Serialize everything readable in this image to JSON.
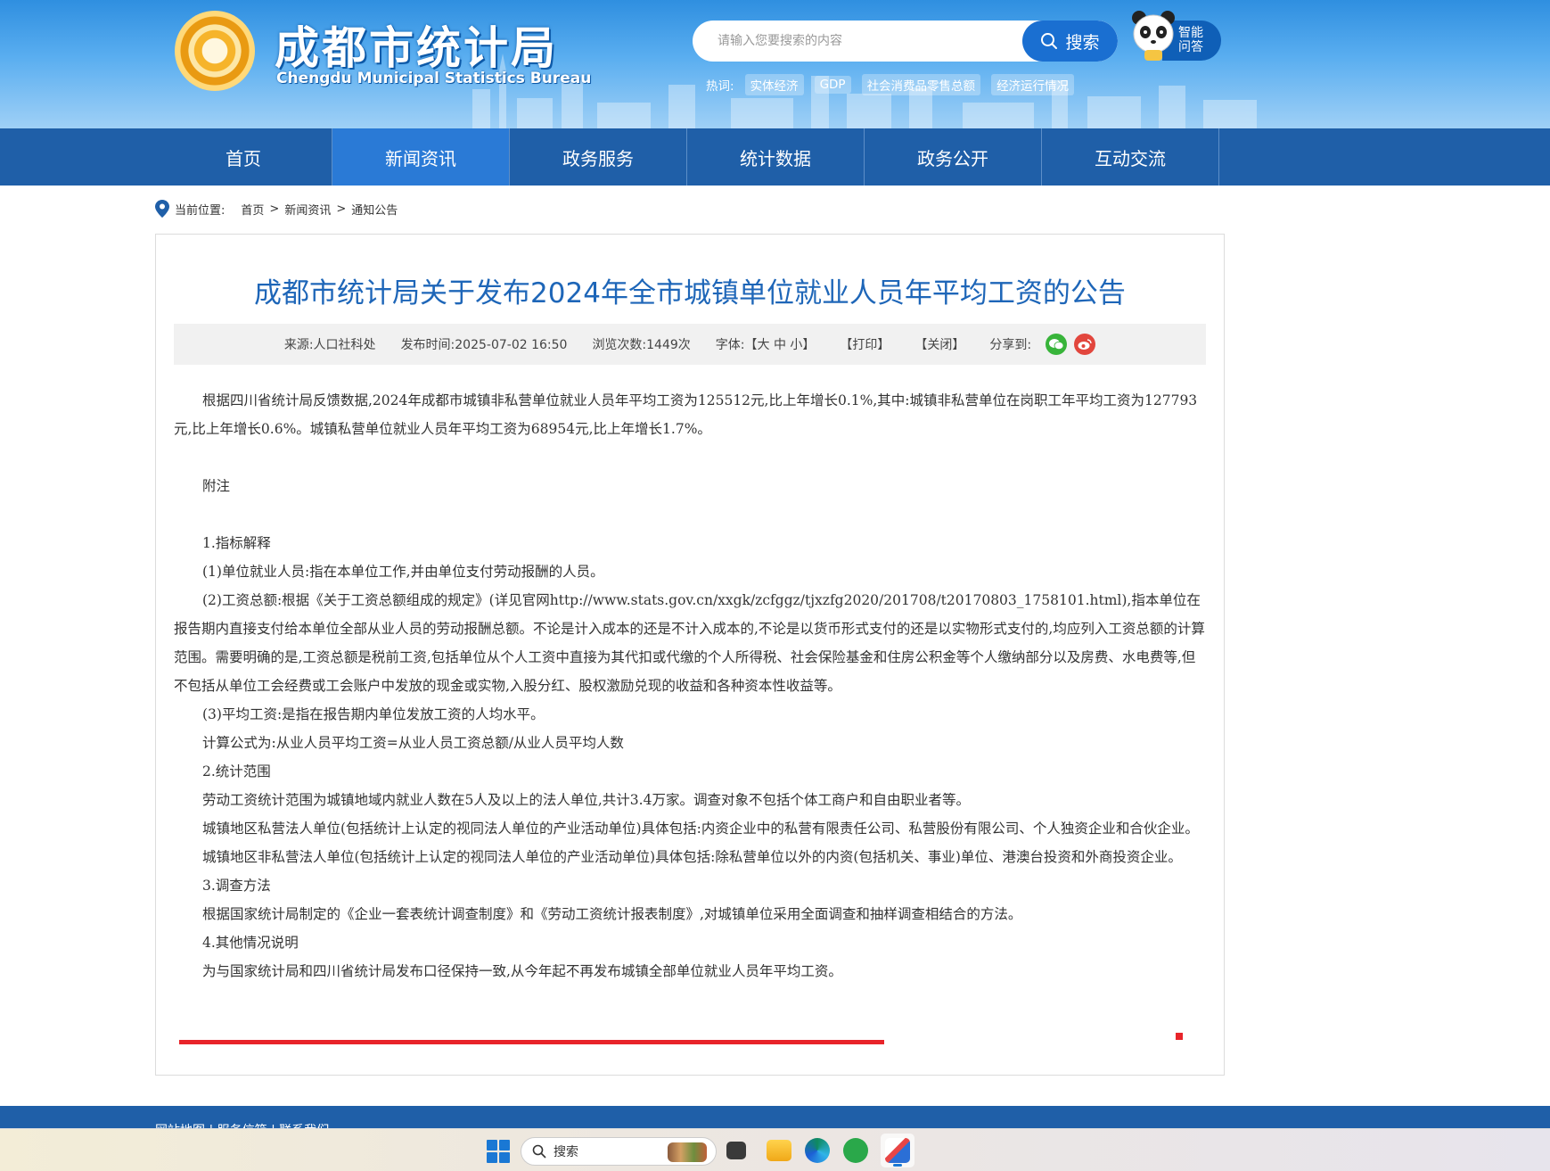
{
  "header": {
    "logo_cn": "成都市统计局",
    "logo_en": "Chengdu Municipal Statistics Bureau",
    "search_placeholder": "请输入您要搜索的内容",
    "search_button": "搜索",
    "ai_line1": "智能",
    "ai_line2": "问答",
    "hot_label": "热词:",
    "hot_tags": [
      "实体经济",
      "GDP",
      "社会消费品零售总额",
      "经济运行情况"
    ]
  },
  "nav": {
    "items": [
      "首页",
      "新闻资讯",
      "政务服务",
      "统计数据",
      "政务公开",
      "互动交流"
    ],
    "active_index": 1
  },
  "breadcrumb": {
    "label": "当前位置:",
    "items": [
      "首页",
      "新闻资讯",
      "通知公告"
    ],
    "sep": ">"
  },
  "article": {
    "title": "成都市统计局关于发布2024年全市城镇单位就业人员年平均工资的公告",
    "meta": {
      "source": "来源:人口社科处",
      "published": "发布时间:2025-07-02 16:50",
      "views": "浏览次数:1449次",
      "font": "字体:【大 中 小】",
      "print": "【打印】",
      "close": "【关闭】",
      "share": "分享到:"
    },
    "paragraphs": [
      "根据四川省统计局反馈数据,2024年成都市城镇非私营单位就业人员年平均工资为125512元,比上年增长0.1%,其中:城镇非私营单位在岗职工年平均工资为127793元,比上年增长0.6%。城镇私营单位就业人员年平均工资为68954元,比上年增长1.7%。",
      "",
      "附注",
      "",
      "1.指标解释",
      "(1)单位就业人员:指在本单位工作,并由单位支付劳动报酬的人员。",
      "(2)工资总额:根据《关于工资总额组成的规定》(详见官网http://www.stats.gov.cn/xxgk/zcfggz/tjxzfg2020/201708/t20170803_1758101.html),指本单位在报告期内直接支付给本单位全部从业人员的劳动报酬总额。不论是计入成本的还是不计入成本的,不论是以货币形式支付的还是以实物形式支付的,均应列入工资总额的计算范围。需要明确的是,工资总额是税前工资,包括单位从个人工资中直接为其代扣或代缴的个人所得税、社会保险基金和住房公积金等个人缴纳部分以及房费、水电费等,但不包括从单位工会经费或工会账户中发放的现金或实物,入股分红、股权激励兑现的收益和各种资本性收益等。",
      "(3)平均工资:是指在报告期内单位发放工资的人均水平。",
      "计算公式为:从业人员平均工资=从业人员工资总额/从业人员平均人数",
      "2.统计范围",
      "劳动工资统计范围为城镇地域内就业人数在5人及以上的法人单位,共计3.4万家。调查对象不包括个体工商户和自由职业者等。",
      "城镇地区私营法人单位(包括统计上认定的视同法人单位的产业活动单位)具体包括:内资企业中的私营有限责任公司、私营股份有限公司、个人独资企业和合伙企业。",
      "城镇地区非私营法人单位(包括统计上认定的视同法人单位的产业活动单位)具体包括:除私营单位以外的内资(包括机关、事业)单位、港澳台投资和外商投资企业。",
      "3.调查方法",
      "根据国家统计局制定的《企业一套表统计调查制度》和《劳动工资统计报表制度》,对城镇单位采用全面调查和抽样调查相结合的方法。",
      "4.其他情况说明",
      "为与国家统计局和四川省统计局发布口径保持一致,从今年起不再发布城镇全部单位就业人员年平均工资。"
    ]
  },
  "footer": {
    "links": "网站地图 | 服务信箱 | 联系我们"
  },
  "taskbar": {
    "search": "搜索"
  },
  "colors": {
    "nav_bg": "#1f5fa8",
    "nav_active": "#2a7ad6",
    "title": "#1e66b8",
    "highlight": "#e8242a"
  }
}
